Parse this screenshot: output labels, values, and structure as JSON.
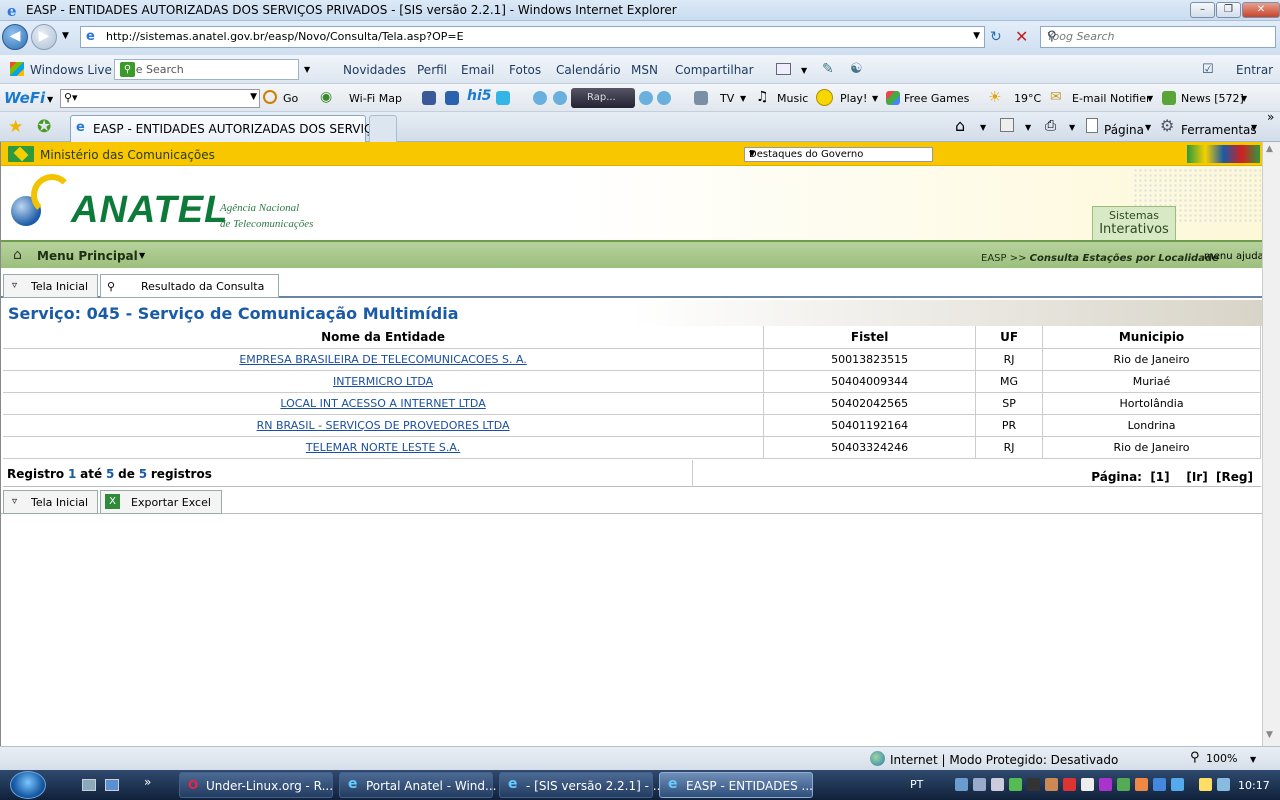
{
  "window": {
    "title": "EASP - ENTIDADES AUTORIZADAS DOS SERVIÇOS PRIVADOS - [SIS versão 2.2.1] - Windows Internet Explorer"
  },
  "address_bar": {
    "url": "http://sistemas.anatel.gov.br/easp/Novo/Consulta/Tela.asp?OP=E",
    "search_placeholder": "Yoog Search"
  },
  "live_toolbar": {
    "brand": "Windows Live",
    "search_placeholder": "Live Search",
    "links": [
      "Novidades",
      "Perfil",
      "Email",
      "Fotos",
      "Calendário",
      "MSN",
      "Compartilhar"
    ],
    "signin": "Entrar"
  },
  "wifi_toolbar": {
    "go": "Go",
    "wifi_map": "Wi-Fi Map",
    "radio": "Rap...",
    "tv": "TV",
    "music": "Music",
    "play": "Play!",
    "games": "Free Games",
    "weather": "19°C",
    "email": "E-mail Notifier",
    "news": "News [572]"
  },
  "tab_bar": {
    "active_tab": "EASP - ENTIDADES AUTORIZADAS DOS SERVIÇO...",
    "page_menu": "Página",
    "tools_menu": "Ferramentas"
  },
  "page": {
    "gov_bar": {
      "ministry": "Ministério das Comunicações",
      "destaques": "Destaques do Governo"
    },
    "header": {
      "logo_word": "ANATEL",
      "sub1": "Agência Nacional",
      "sub2": "de Telecomunicações",
      "sistemas": "Sistemas",
      "interativos": "Interativos"
    },
    "menu": {
      "main": "Menu Principal",
      "crumb_prefix": "EASP >>",
      "crumb_page": "Consulta Estações por Localidade",
      "menu": "menu",
      "ajuda": "ajuda"
    },
    "tabs_top": {
      "home": "Tela Inicial",
      "result": "Resultado da Consulta"
    },
    "service_title": "Serviço: 045 - Serviço de Comunicação Multimídia",
    "table": {
      "headers": [
        "Nome da Entidade",
        "Fistel",
        "UF",
        "Municipio"
      ],
      "rows": [
        [
          "EMPRESA BRASILEIRA DE TELECOMUNICACOES S. A.",
          "50013823515",
          "RJ",
          "Rio de Janeiro"
        ],
        [
          "INTERMICRO LTDA",
          "50404009344",
          "MG",
          "Muriaé"
        ],
        [
          "LOCAL INT ACESSO A INTERNET LTDA",
          "50402042565",
          "SP",
          "Hortolândia"
        ],
        [
          "RN BRASIL - SERVIÇOS DE PROVEDORES LTDA",
          "50401192164",
          "PR",
          "Londrina"
        ],
        [
          "TELEMAR NORTE LESTE S.A.",
          "50403324246",
          "RJ",
          "Rio de Janeiro"
        ]
      ]
    },
    "footer": {
      "registro": "Registro",
      "from": "1",
      "ate": "até",
      "to": "5",
      "de": "de",
      "total": "5",
      "registros": "registros",
      "pagina": "Página:  [1]    [Ir]  [Reg]"
    },
    "tabs_bottom": {
      "home": "Tela Inicial",
      "excel": "Exportar Excel"
    }
  },
  "status_bar": {
    "zone": "Internet | Modo Protegido: Desativado",
    "zoom": "100%"
  },
  "taskbar": {
    "tasks": [
      "Under-Linux.org - R...",
      "Portal Anatel - Wind...",
      "- [SIS versão 2.2.1] - ...",
      "EASP - ENTIDADES ..."
    ],
    "lang": "PT",
    "clock": "10:17"
  }
}
